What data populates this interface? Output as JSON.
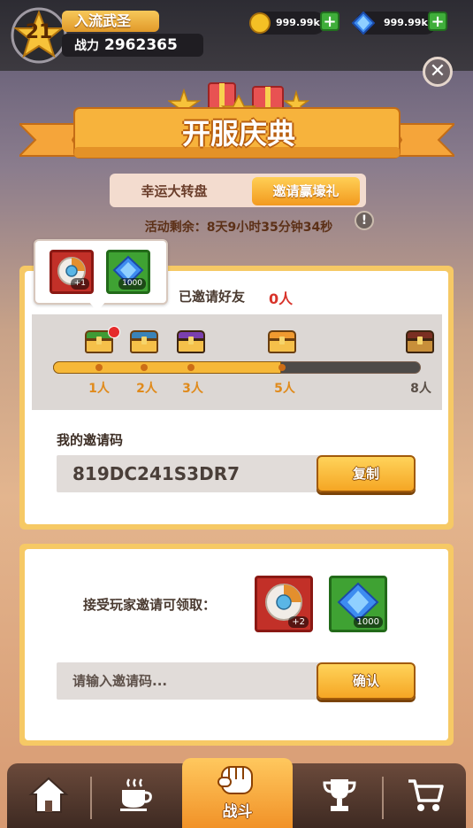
{
  "header": {
    "level": "21",
    "player_name": "入流武圣",
    "power_label": "战力",
    "power_value": "2962365",
    "coins": "999.99k",
    "gems": "999.99k"
  },
  "event": {
    "title": "开服庆典",
    "tabs": [
      {
        "label": "幸运大转盘"
      },
      {
        "label": "邀请赢壕礼"
      }
    ],
    "timer": "活动剩余：8天9小时35分钟34秒"
  },
  "invite_panel": {
    "tooltip_rewards": [
      {
        "icon": "wheel-token-icon",
        "qty": "+1"
      },
      {
        "icon": "gem-icon",
        "qty": "1000"
      }
    ],
    "invited_label": "已邀请好友",
    "invited_count": "0人",
    "progress": 0.62,
    "milestones": [
      "1人",
      "2人",
      "3人",
      "5人",
      "8人"
    ],
    "code_label": "我的邀请码",
    "code_value": "819DC241S3DR7",
    "copy_button": "复制"
  },
  "accept_panel": {
    "label": "接受玩家邀请可领取：",
    "rewards": [
      {
        "icon": "wheel-token-icon",
        "qty": "+2"
      },
      {
        "icon": "gem-icon",
        "qty": "1000"
      }
    ],
    "input_placeholder": "请输入邀请码...",
    "confirm_button": "确认"
  },
  "nav": {
    "items": [
      "home-icon",
      "coffee-icon",
      "fist-icon",
      "trophy-icon",
      "cart-icon"
    ],
    "active_label": "战斗"
  },
  "colors": {
    "accent": "#f6b838",
    "panel_border": "#f6c965",
    "highlight_red": "#d8332a"
  }
}
